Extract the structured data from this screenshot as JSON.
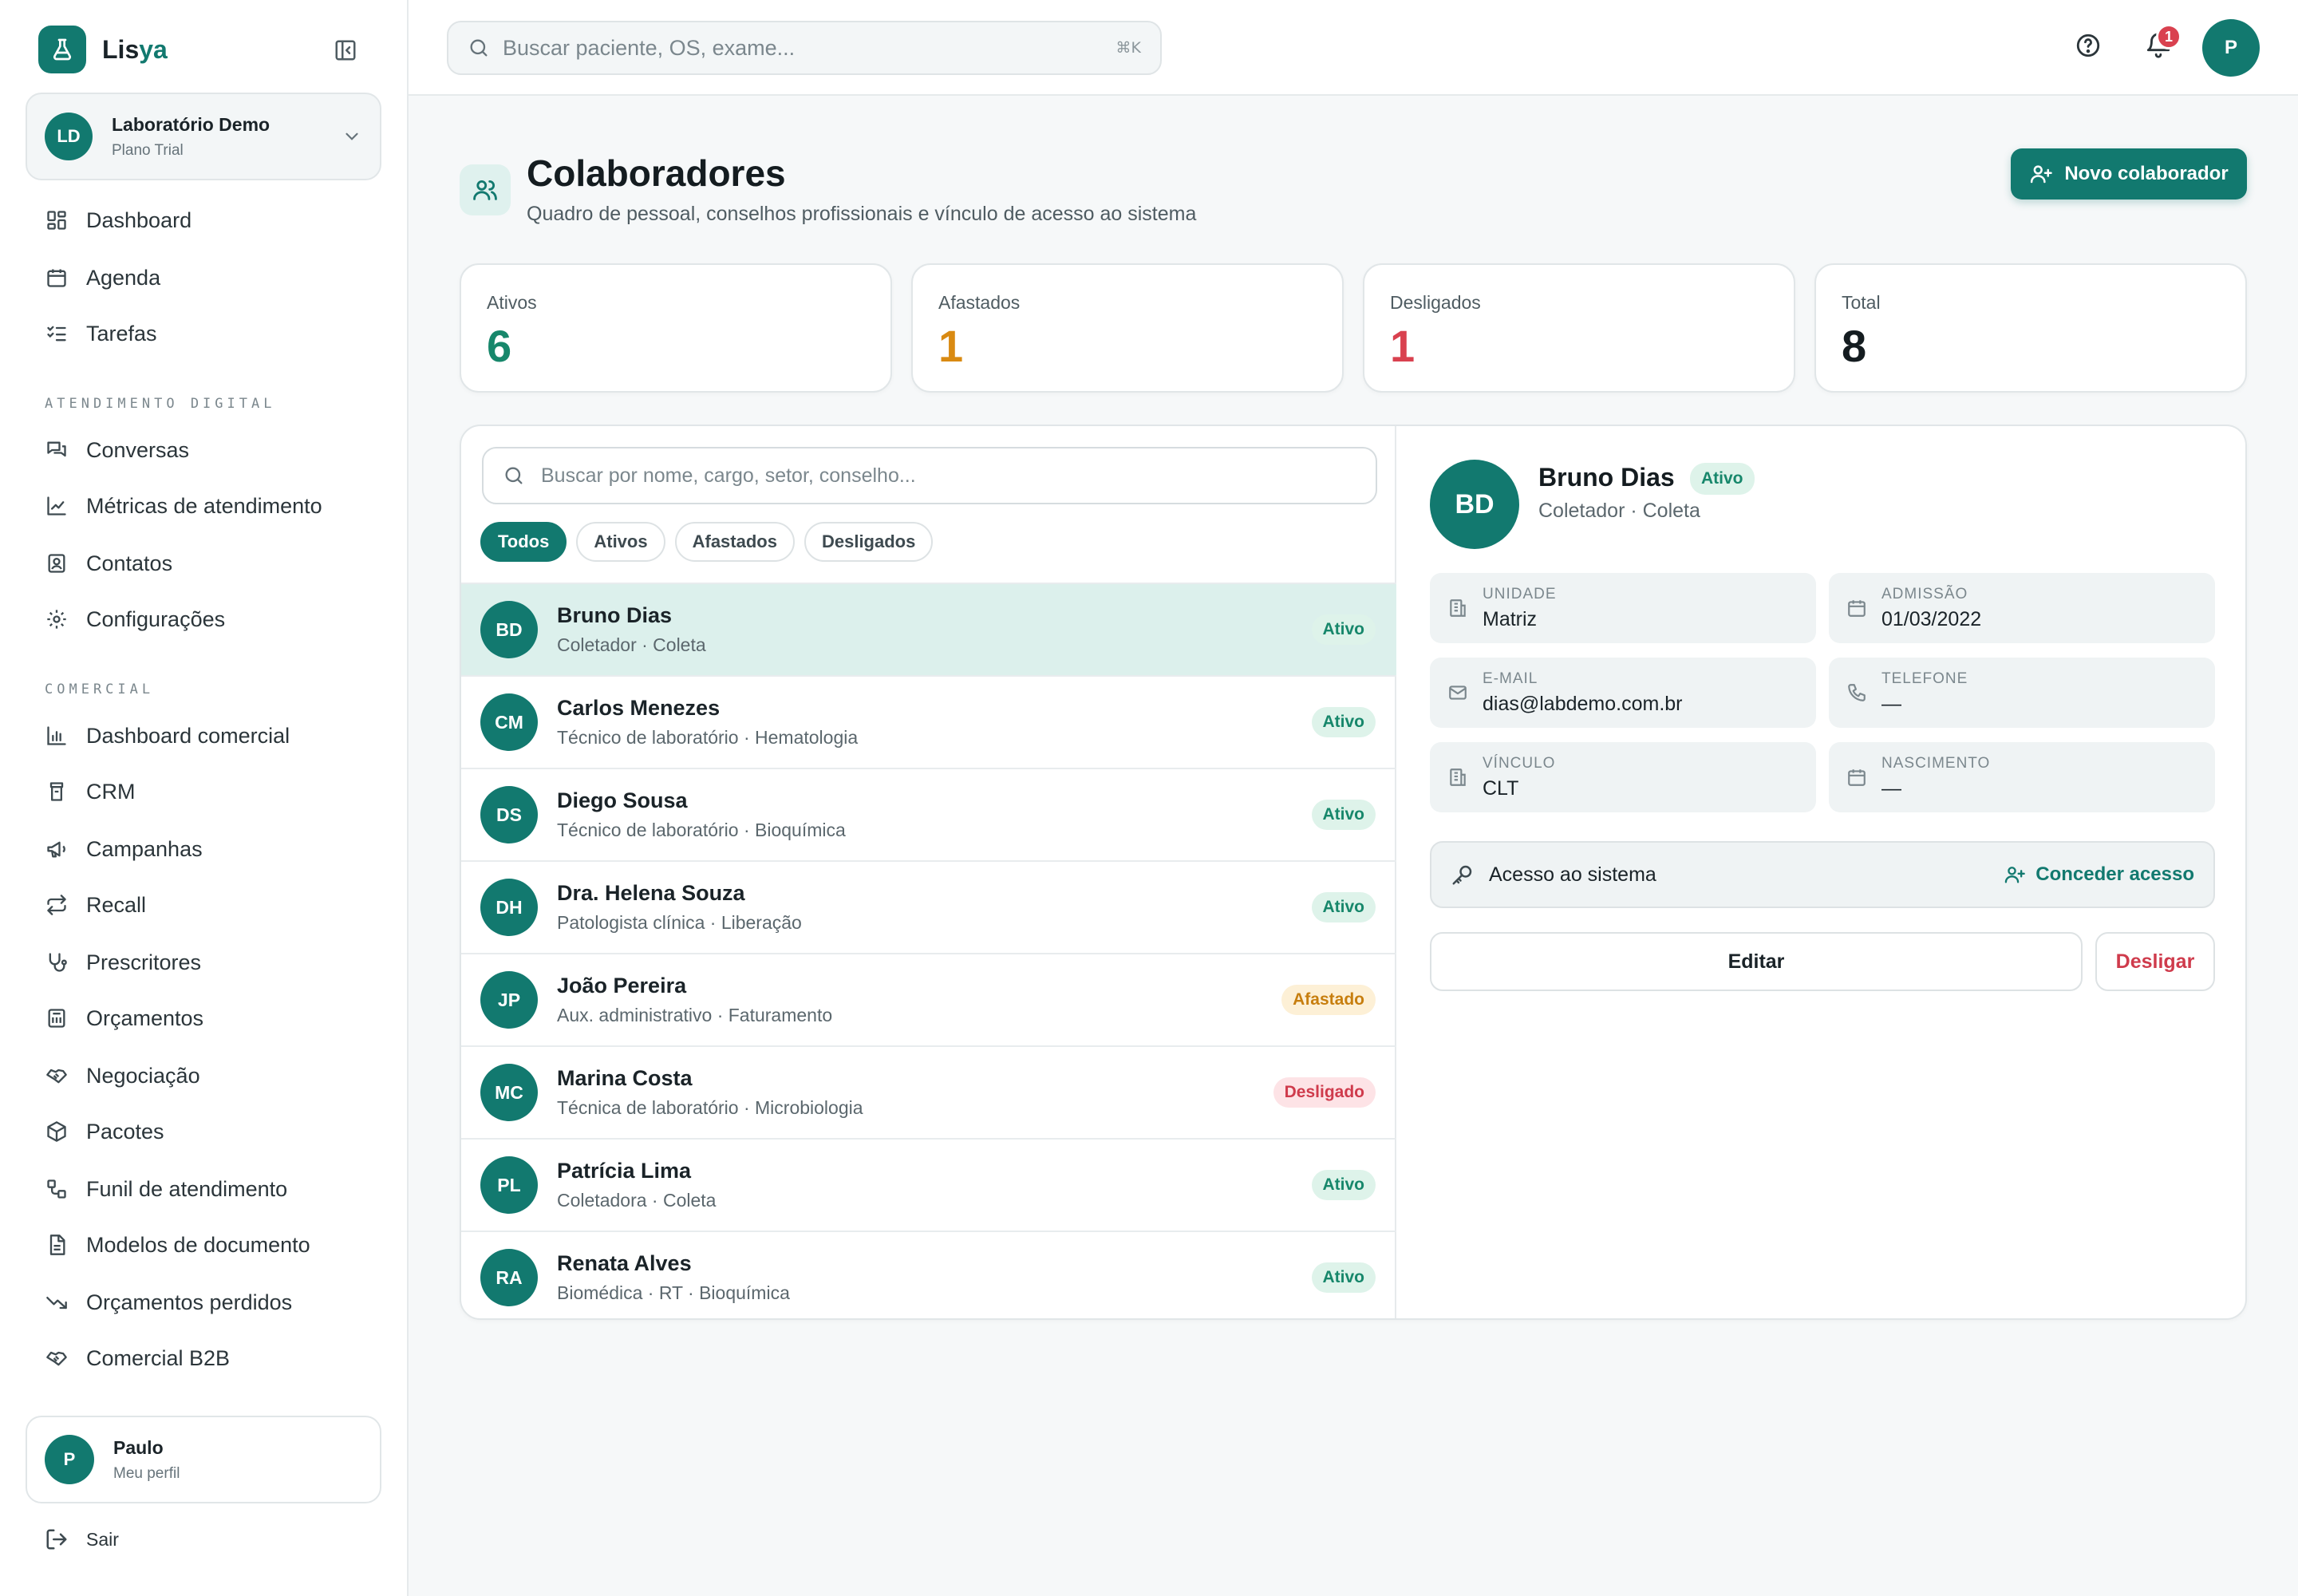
{
  "brand": {
    "name_main": "Lis",
    "name_accent": "ya"
  },
  "org": {
    "initials": "LD",
    "name": "Laboratório Demo",
    "plan": "Plano Trial"
  },
  "nav": {
    "main": [
      {
        "label": "Dashboard",
        "icon": "dashboard-icon"
      },
      {
        "label": "Agenda",
        "icon": "calendar-icon"
      },
      {
        "label": "Tarefas",
        "icon": "checklist-icon"
      }
    ],
    "section_atendimento": "ATENDIMENTO DIGITAL",
    "atendimento": [
      {
        "label": "Conversas",
        "icon": "chat-icon"
      },
      {
        "label": "Métricas de atendimento",
        "icon": "line-chart-icon"
      },
      {
        "label": "Contatos",
        "icon": "contact-icon"
      },
      {
        "label": "Configurações",
        "icon": "gear-icon"
      }
    ],
    "section_comercial": "COMERCIAL",
    "comercial": [
      {
        "label": "Dashboard comercial",
        "icon": "bar-chart-icon"
      },
      {
        "label": "CRM",
        "icon": "crm-icon"
      },
      {
        "label": "Campanhas",
        "icon": "megaphone-icon"
      },
      {
        "label": "Recall",
        "icon": "repeat-icon"
      },
      {
        "label": "Prescritores",
        "icon": "stethoscope-icon"
      },
      {
        "label": "Orçamentos",
        "icon": "calculator-icon"
      },
      {
        "label": "Negociação",
        "icon": "handshake-icon"
      },
      {
        "label": "Pacotes",
        "icon": "package-icon"
      },
      {
        "label": "Funil de atendimento",
        "icon": "workflow-icon"
      },
      {
        "label": "Modelos de documento",
        "icon": "document-icon"
      },
      {
        "label": "Orçamentos perdidos",
        "icon": "trending-down-icon"
      },
      {
        "label": "Comercial B2B",
        "icon": "handshake-icon"
      }
    ]
  },
  "profile": {
    "initial": "P",
    "name": "Paulo",
    "link": "Meu perfil"
  },
  "logout": "Sair",
  "topbar": {
    "search_placeholder": "Buscar paciente, OS, exame...",
    "shortcut": "⌘K",
    "notifications": "1",
    "user_initial": "P"
  },
  "page": {
    "title": "Colaboradores",
    "subtitle": "Quadro de pessoal, conselhos profissionais e vínculo de acesso ao sistema",
    "new_button": "Novo colaborador"
  },
  "stats": [
    {
      "label": "Ativos",
      "value": "6",
      "color": "#17876b"
    },
    {
      "label": "Afastados",
      "value": "1",
      "color": "#d98a12"
    },
    {
      "label": "Desligados",
      "value": "1",
      "color": "#d9414f"
    },
    {
      "label": "Total",
      "value": "8",
      "color": "#141c20"
    }
  ],
  "list": {
    "search_placeholder": "Buscar por nome, cargo, setor, conselho...",
    "filters": [
      "Todos",
      "Ativos",
      "Afastados",
      "Desligados"
    ],
    "rows": [
      {
        "initials": "BD",
        "name": "Bruno Dias",
        "role": "Coletador · Coleta",
        "status": "Ativo"
      },
      {
        "initials": "CM",
        "name": "Carlos Menezes",
        "role": "Técnico de laboratório · Hematologia",
        "status": "Ativo"
      },
      {
        "initials": "DS",
        "name": "Diego Sousa",
        "role": "Técnico de laboratório · Bioquímica",
        "status": "Ativo"
      },
      {
        "initials": "DH",
        "name": "Dra. Helena Souza",
        "role": "Patologista clínica · Liberação",
        "status": "Ativo"
      },
      {
        "initials": "JP",
        "name": "João Pereira",
        "role": "Aux. administrativo · Faturamento",
        "status": "Afastado"
      },
      {
        "initials": "MC",
        "name": "Marina Costa",
        "role": "Técnica de laboratório · Microbiologia",
        "status": "Desligado"
      },
      {
        "initials": "PL",
        "name": "Patrícia Lima",
        "role": "Coletadora · Coleta",
        "status": "Ativo"
      },
      {
        "initials": "RA",
        "name": "Renata Alves",
        "role": "Biomédica · RT · Bioquímica",
        "status": "Ativo"
      }
    ]
  },
  "detail": {
    "initials": "BD",
    "name": "Bruno Dias",
    "status": "Ativo",
    "role": "Coletador · Coleta",
    "fields": {
      "unidade": {
        "label": "UNIDADE",
        "value": "Matriz"
      },
      "admissao": {
        "label": "ADMISSÃO",
        "value": "01/03/2022"
      },
      "email": {
        "label": "E-MAIL",
        "value": "dias@labdemo.com.br"
      },
      "telefone": {
        "label": "TELEFONE",
        "value": "—"
      },
      "vinculo": {
        "label": "VÍNCULO",
        "value": "CLT"
      },
      "nascimento": {
        "label": "NASCIMENTO",
        "value": "—"
      }
    },
    "access_label": "Acesso ao sistema",
    "grant_label": "Conceder acesso",
    "edit_label": "Editar",
    "fire_label": "Desligar"
  }
}
